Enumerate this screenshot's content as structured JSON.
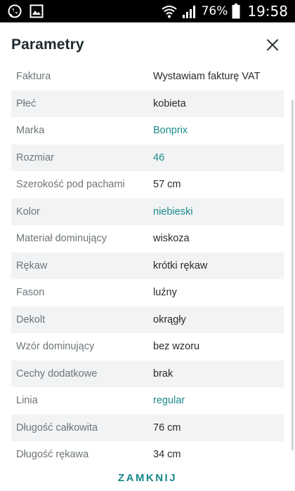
{
  "status_bar": {
    "battery_percent": "76%",
    "time": "19:58",
    "icons": [
      "whatsapp-icon",
      "gallery-icon",
      "wifi-icon",
      "signal-icon",
      "battery-icon"
    ]
  },
  "header": {
    "title": "Parametry"
  },
  "params": [
    {
      "label": "Faktura",
      "value": "Wystawiam fakturę VAT",
      "link": false
    },
    {
      "label": "Płeć",
      "value": "kobieta",
      "link": false
    },
    {
      "label": "Marka",
      "value": "Bonprix",
      "link": true
    },
    {
      "label": "Rozmiar",
      "value": "46",
      "link": true
    },
    {
      "label": "Szerokość pod pachami",
      "value": "57 cm",
      "link": false
    },
    {
      "label": "Kolor",
      "value": "niebieski",
      "link": true
    },
    {
      "label": "Materiał dominujący",
      "value": "wiskoza",
      "link": false
    },
    {
      "label": "Rękaw",
      "value": "krótki rękaw",
      "link": false
    },
    {
      "label": "Fason",
      "value": "luźny",
      "link": false
    },
    {
      "label": "Dekolt",
      "value": "okrągły",
      "link": false
    },
    {
      "label": "Wzór dominujący",
      "value": "bez wzoru",
      "link": false
    },
    {
      "label": "Cechy dodatkowe",
      "value": "brak",
      "link": false
    },
    {
      "label": "Linia",
      "value": "regular",
      "link": true
    },
    {
      "label": "Długość całkowita",
      "value": "76 cm",
      "link": false
    },
    {
      "label": "Długość rękawa",
      "value": "34 cm",
      "link": false
    }
  ],
  "footer": {
    "close_label": "ZAMKNIJ"
  },
  "colors": {
    "accent": "#1a8a8c",
    "stripe": "#f2f3f4",
    "label": "#6d7579"
  }
}
